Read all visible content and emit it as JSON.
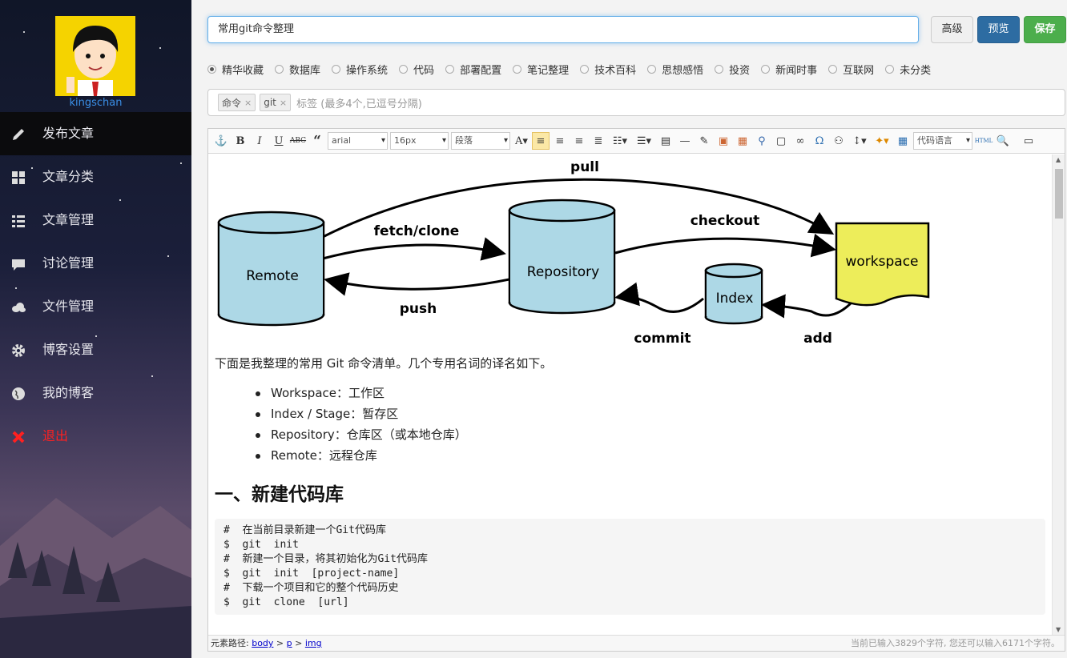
{
  "user": {
    "name": "kingschan"
  },
  "nav": [
    {
      "label": "发布文章",
      "icon": "pencil-icon"
    },
    {
      "label": "文章分类",
      "icon": "grid-icon"
    },
    {
      "label": "文章管理",
      "icon": "list-icon"
    },
    {
      "label": "讨论管理",
      "icon": "comment-icon"
    },
    {
      "label": "文件管理",
      "icon": "cloud-icon"
    },
    {
      "label": "博客设置",
      "icon": "gear-icon"
    },
    {
      "label": "我的博客",
      "icon": "globe-icon"
    },
    {
      "label": "退出",
      "icon": "close-icon"
    }
  ],
  "title_value": "常用git命令整理",
  "buttons": {
    "advanced": "高级",
    "preview": "预览",
    "save": "保存"
  },
  "categories": [
    "精华收藏",
    "数据库",
    "操作系统",
    "代码",
    "部署配置",
    "笔记整理",
    "技术百科",
    "思想感悟",
    "投资",
    "新闻时事",
    "互联网",
    "未分类"
  ],
  "selected_category": "精华收藏",
  "tags": [
    "命令",
    "git"
  ],
  "tag_placeholder": "标签 (最多4个,已逗号分隔)",
  "toolbar": {
    "font": "arial",
    "size": "16px",
    "paragraph": "段落",
    "code_lang": "代码语言",
    "html": "HTML"
  },
  "diagram": {
    "remote": "Remote",
    "repository": "Repository",
    "index": "Index",
    "workspace": "workspace",
    "pull": "pull",
    "fetch_clone": "fetch/clone",
    "push": "push",
    "checkout": "checkout",
    "commit": "commit",
    "add": "add"
  },
  "article": {
    "intro": "下面是我整理的常用 Git 命令清单。几个专用名词的译名如下。",
    "terms": [
      "Workspace：工作区",
      "Index / Stage：暂存区",
      "Repository：仓库区（或本地仓库）",
      "Remote：远程仓库"
    ],
    "heading": "一、新建代码库",
    "code": "#  在当前目录新建一个Git代码库\n$  git  init\n#  新建一个目录，将其初始化为Git代码库\n$  git  init  [project-name]\n#  下载一个项目和它的整个代码历史\n$  git  clone  [url]"
  },
  "status": {
    "path_label": "元素路径:",
    "path": [
      "body",
      "p",
      "img"
    ],
    "count": "当前已输入3829个字符, 您还可以输入6171个字符。"
  },
  "colors": {
    "accent": "#2d6ca2",
    "save": "#4cae4c",
    "cylinder": "#add8e6",
    "workspace": "#eded5a"
  }
}
